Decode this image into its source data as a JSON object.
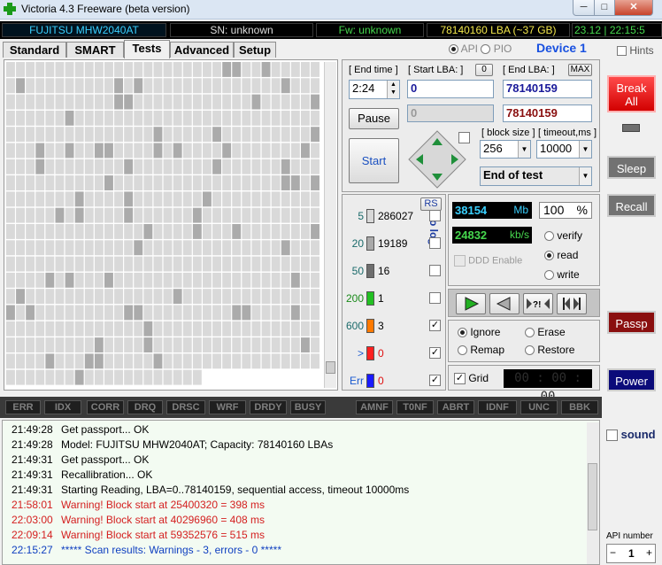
{
  "window": {
    "title": "Victoria 4.3 Freeware (beta version)",
    "min": "─",
    "max": "□",
    "close": "✕"
  },
  "info": {
    "model": "FUJITSU MHW2040AT",
    "sn": "SN: unknown",
    "fw": "Fw: unknown",
    "lba": "78140160 LBA (~37 GB)",
    "clock": "23.12 | 22:15:5"
  },
  "tabs": [
    "Standard",
    "SMART",
    "Tests",
    "Advanced",
    "Setup"
  ],
  "active_tab": "Tests",
  "mode": {
    "api": "API",
    "pio": "PIO",
    "selected": "API",
    "device": "Device 1",
    "hints": "Hints"
  },
  "test": {
    "end_time_label": "[ End time ]",
    "end_time": "2:24",
    "start_lba_label": "[ Start LBA: ]",
    "start_lba_btn": "0",
    "start_lba": "0",
    "end_lba_label": "[ End LBA: ]",
    "end_lba_btn": "MAX",
    "end_lba": "78140159",
    "cur_lba": "0",
    "cur_end": "78140159",
    "pause": "Pause",
    "start": "Start",
    "block_size_label": "[ block size ]",
    "block_size": "256",
    "timeout_label": "[ timeout,ms ]",
    "timeout": "10000",
    "end_action": "End of test"
  },
  "ranges": {
    "rs": "RS",
    "to_log": "to log:",
    "items": [
      {
        "ms": "5",
        "count": "286027",
        "color": "#d8d8d8",
        "log": false
      },
      {
        "ms": "20",
        "count": "19189",
        "color": "#a9a9a9",
        "log": false
      },
      {
        "ms": "50",
        "count": "16",
        "color": "#6e6e6e",
        "log": false
      },
      {
        "ms": "200",
        "count": "1",
        "color": "#22c022",
        "log": false
      },
      {
        "ms": "600",
        "count": "3",
        "color": "#ff7a00",
        "log": true
      },
      {
        "ms": ">",
        "count": "0",
        "color": "#ff2020",
        "log": true
      },
      {
        "ms": "Err",
        "count": "0",
        "color": "#1a1aff",
        "log": true
      }
    ]
  },
  "speed": {
    "mb": "38154",
    "mb_unit": "Mb",
    "percent": "100",
    "percent_unit": "%",
    "kbs": "24832",
    "kbs_unit": "kb/s",
    "ddd": "DDD Enable"
  },
  "op": {
    "verify": "verify",
    "read": "read",
    "write": "write",
    "selected": "read"
  },
  "repair": {
    "ignore": "Ignore",
    "erase": "Erase",
    "remap": "Remap",
    "restore": "Restore",
    "selected": "Ignore"
  },
  "grid": {
    "label": "Grid",
    "timer": "00 : 00 : 00"
  },
  "side": {
    "break_all": "Break All",
    "sleep": "Sleep",
    "recall": "Recall",
    "passp": "Passp",
    "power": "Power",
    "sound": "sound",
    "api_number_label": "API number",
    "api_number": "1"
  },
  "status_flags": [
    "ERR",
    "IDX",
    "CORR",
    "DRQ",
    "DRSC",
    "WRF",
    "DRDY",
    "BUSY",
    "AMNF",
    "T0NF",
    "ABRT",
    "IDNF",
    "UNC",
    "BBK"
  ],
  "log": [
    {
      "time": "21:49:28",
      "text": "Get passport... OK",
      "kind": "normal"
    },
    {
      "time": "21:49:28",
      "text": "Model: FUJITSU MHW2040AT; Capacity: 78140160 LBAs",
      "kind": "normal"
    },
    {
      "time": "21:49:31",
      "text": "Get passport... OK",
      "kind": "normal"
    },
    {
      "time": "21:49:31",
      "text": "Recallibration... OK",
      "kind": "normal"
    },
    {
      "time": "21:49:31",
      "text": "Starting Reading, LBA=0..78140159, sequential access, timeout 10000ms",
      "kind": "normal"
    },
    {
      "time": "21:58:01",
      "text": "Warning! Block start at 25400320 = 398 ms",
      "kind": "warn"
    },
    {
      "time": "22:03:00",
      "text": "Warning! Block start at 40296960 = 408 ms",
      "kind": "warn"
    },
    {
      "time": "22:09:14",
      "text": "Warning! Block start at 59352576 = 515 ms",
      "kind": "warn"
    },
    {
      "time": "22:15:27",
      "text": "***** Scan results: Warnings - 3, errors - 0 *****",
      "kind": "result"
    }
  ]
}
